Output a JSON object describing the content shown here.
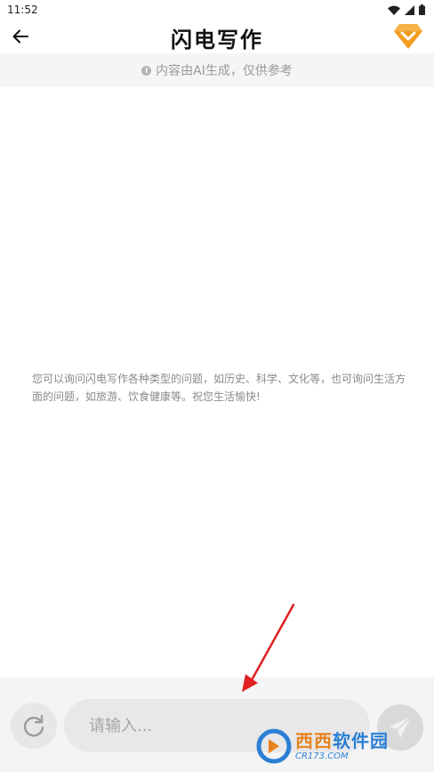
{
  "status_bar": {
    "time": "11:52"
  },
  "header": {
    "title": "闪电写作"
  },
  "notice": {
    "icon_glyph": "i",
    "text": "内容由AI生成，仅供参考"
  },
  "chat": {
    "intro": "您可以询问闪电写作各种类型的问题，如历史、科学、文化等，也可询问生活方面的问题，如旅游、饮食健康等。祝您生活愉快!"
  },
  "composer": {
    "placeholder": "请输入...",
    "value": ""
  },
  "colors": {
    "accent_orange": "#f39c1f",
    "annotation_red": "#e02020",
    "watermark_blue": "#2a7fd4"
  },
  "watermark": {
    "title_a": "西西",
    "title_b": "软件园",
    "url": "CR173.COM"
  }
}
